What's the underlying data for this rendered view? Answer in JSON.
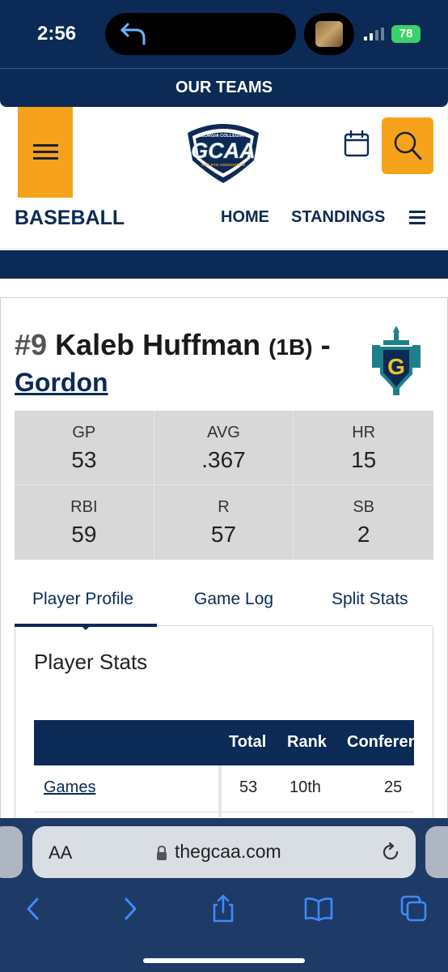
{
  "status_bar": {
    "time": "2:56",
    "battery": "78"
  },
  "site_nav": {
    "our_teams": "OUR TEAMS"
  },
  "header": {
    "logo_top": "GEORGIA COLLEGIATE",
    "logo_main": "GCAA",
    "logo_bottom": "ATHLETIC ASSOCIATION",
    "sport": "BASEBALL",
    "nav": {
      "home": "HOME",
      "standings": "STANDINGS"
    }
  },
  "player": {
    "number": "#9",
    "name": "Kaleb Huffman",
    "position": "(1B)",
    "dash": "-",
    "team": "Gordon",
    "team_logo_letter": "G"
  },
  "summary_stats": [
    {
      "label": "GP",
      "value": "53"
    },
    {
      "label": "AVG",
      "value": ".367"
    },
    {
      "label": "HR",
      "value": "15"
    },
    {
      "label": "RBI",
      "value": "59"
    },
    {
      "label": "R",
      "value": "57"
    },
    {
      "label": "SB",
      "value": "2"
    }
  ],
  "tabs": [
    "Player Profile",
    "Game Log",
    "Split Stats"
  ],
  "section_title": "Player Stats",
  "table": {
    "headers": [
      "Total",
      "Rank",
      "Conference"
    ],
    "rows": [
      {
        "label": "Games",
        "total": "53",
        "rank": "10th",
        "conference": "25"
      }
    ]
  },
  "browser": {
    "aa": "AA",
    "url": "thegcaa.com"
  },
  "colors": {
    "navy": "#0b2a55",
    "orange": "#f7a21b",
    "safari_bar": "#1e3a66"
  }
}
